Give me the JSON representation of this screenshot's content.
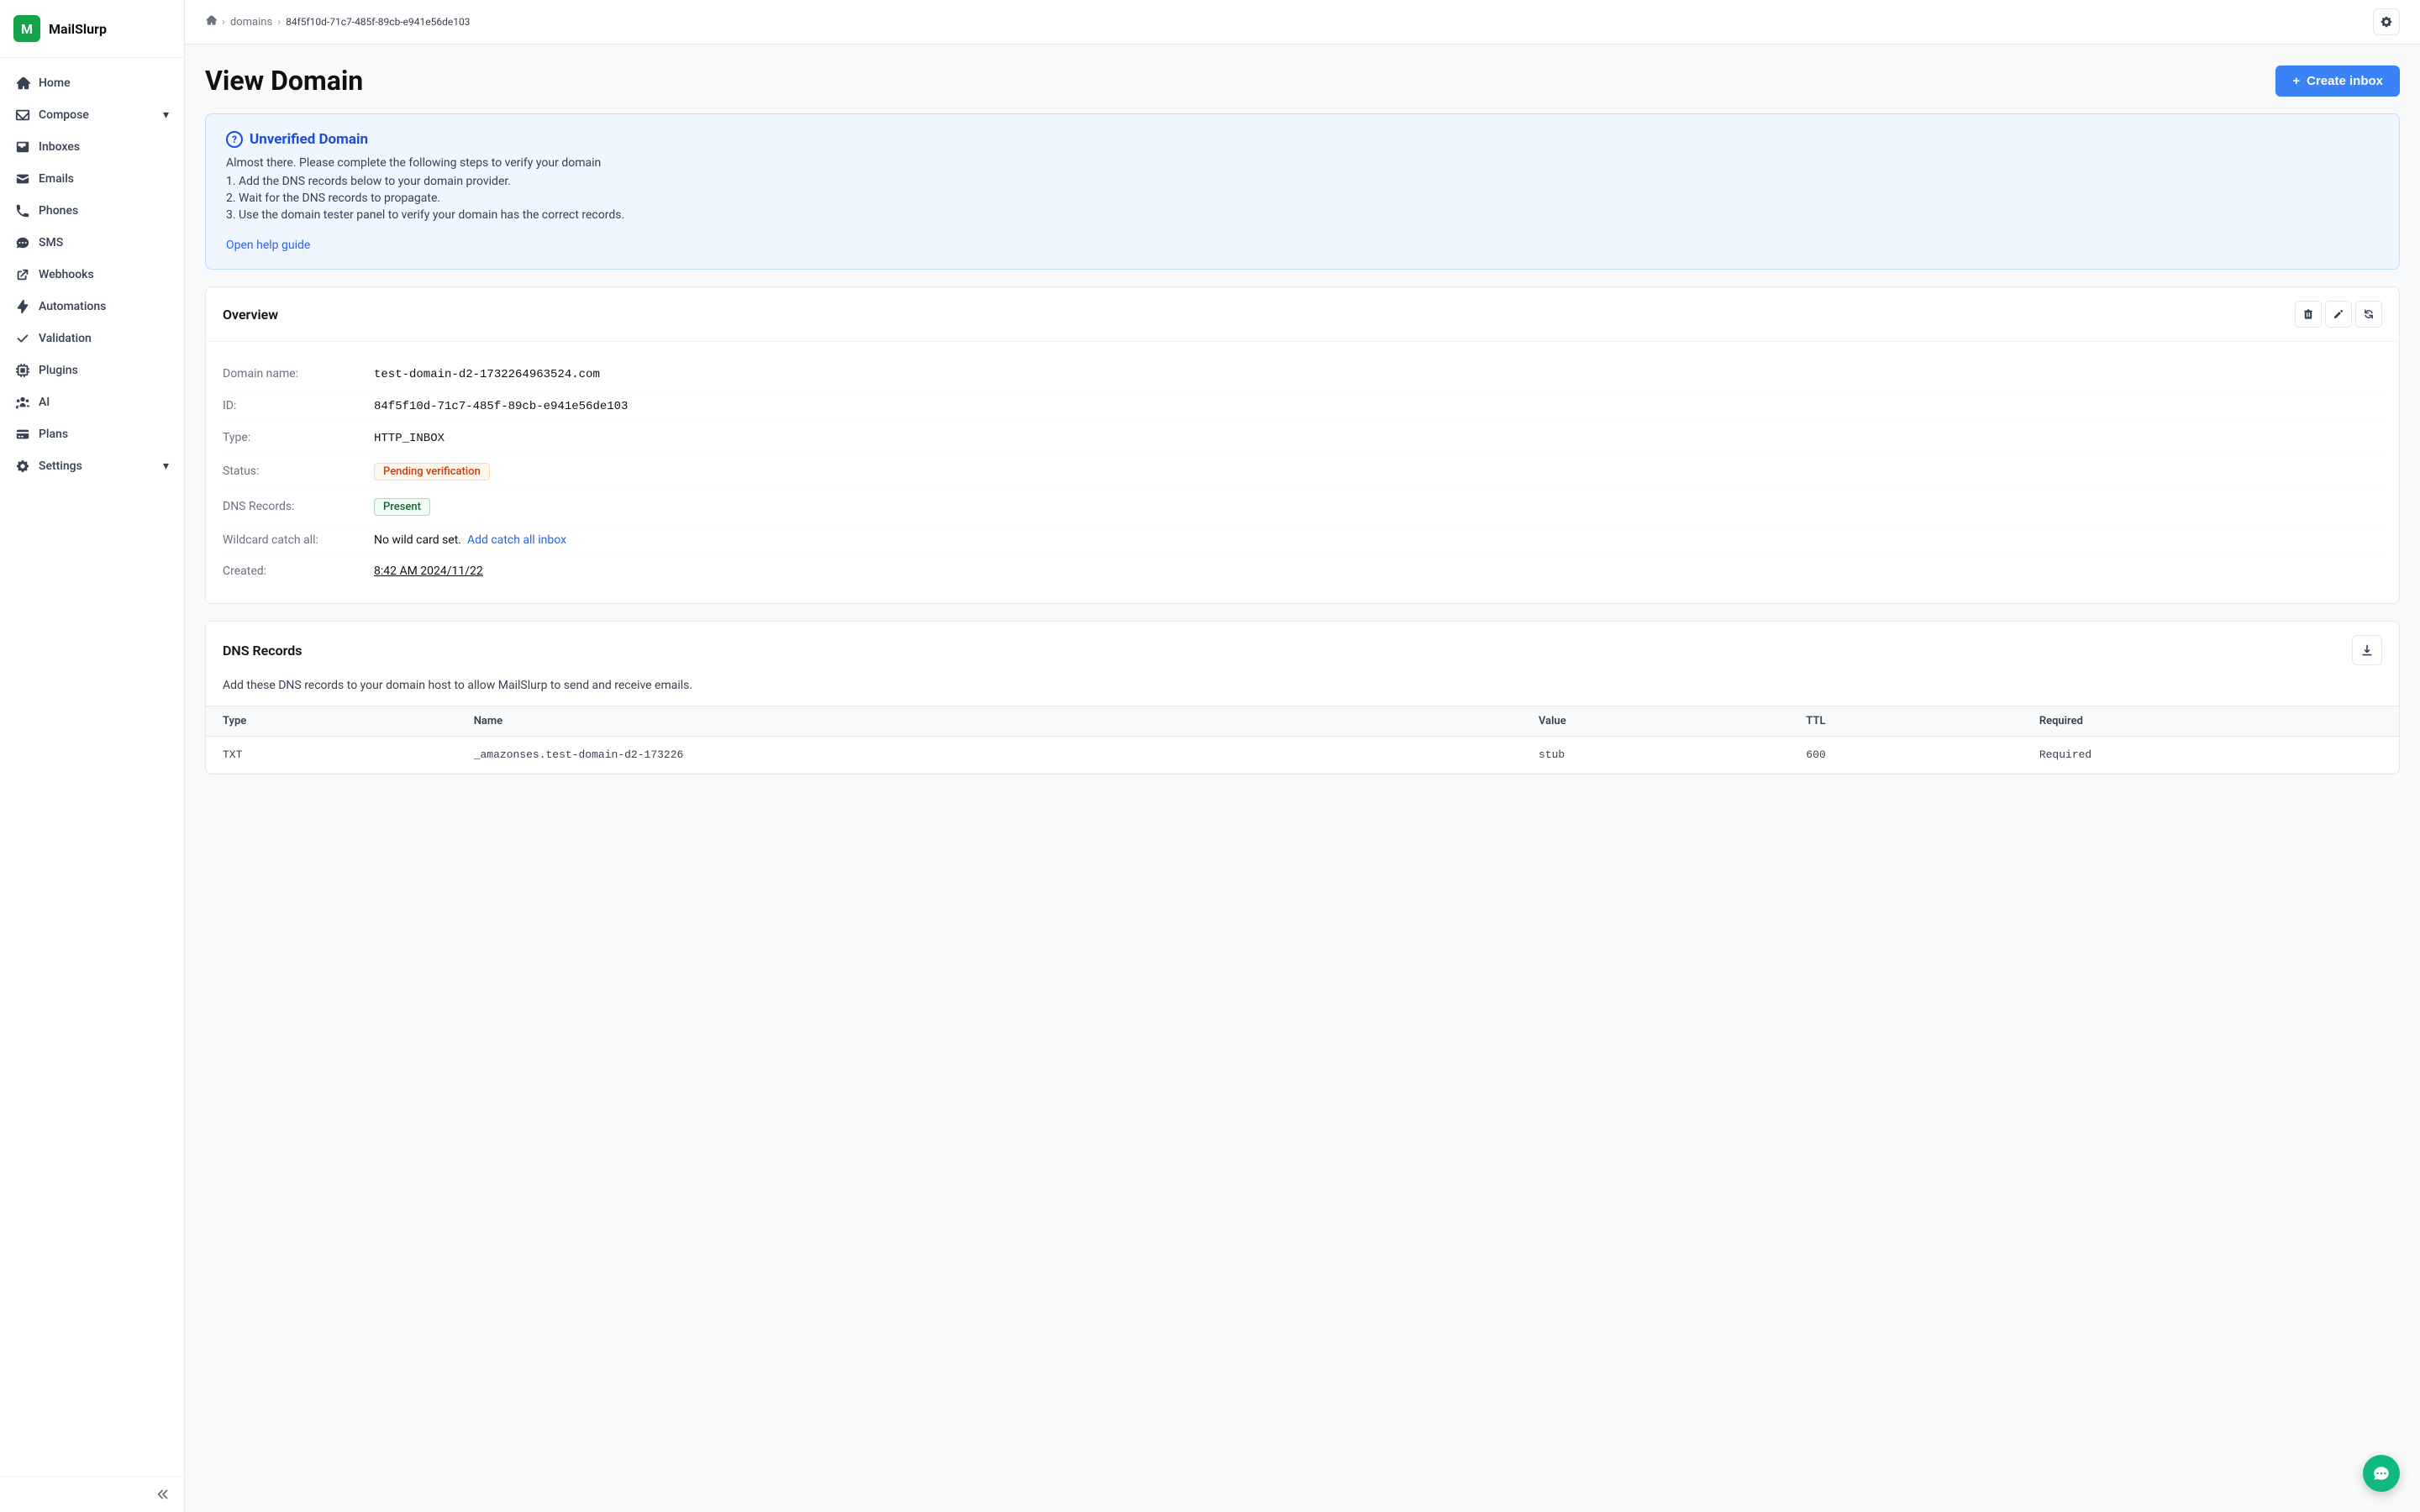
{
  "sidebar": {
    "logo": {
      "letter": "M",
      "name": "MailSlurp"
    },
    "nav_items": [
      {
        "id": "home",
        "label": "Home",
        "icon": "home"
      },
      {
        "id": "compose",
        "label": "Compose",
        "icon": "compose",
        "has_chevron": true
      },
      {
        "id": "inboxes",
        "label": "Inboxes",
        "icon": "inbox"
      },
      {
        "id": "emails",
        "label": "Emails",
        "icon": "email"
      },
      {
        "id": "phones",
        "label": "Phones",
        "icon": "phone"
      },
      {
        "id": "sms",
        "label": "SMS",
        "icon": "sms"
      },
      {
        "id": "webhooks",
        "label": "Webhooks",
        "icon": "webhook"
      },
      {
        "id": "automations",
        "label": "Automations",
        "icon": "automation"
      },
      {
        "id": "validation",
        "label": "Validation",
        "icon": "validation"
      },
      {
        "id": "plugins",
        "label": "Plugins",
        "icon": "plugins"
      },
      {
        "id": "ai",
        "label": "AI",
        "icon": "ai"
      },
      {
        "id": "plans",
        "label": "Plans",
        "icon": "plans"
      },
      {
        "id": "settings",
        "label": "Settings",
        "icon": "settings",
        "has_chevron": true
      }
    ],
    "collapse_label": "Collapse"
  },
  "breadcrumb": {
    "home_icon": "home",
    "domains_label": "domains",
    "domain_id": "84f5f10d-71c7-485f-89cb-e941e56de103"
  },
  "header": {
    "page_title": "View Domain",
    "settings_icon": "gear",
    "create_inbox_label": "Create inbox",
    "create_inbox_plus": "+"
  },
  "alert": {
    "icon": "?",
    "title": "Unverified Domain",
    "subtitle": "Almost there. Please complete the following steps to verify your domain",
    "steps": [
      "1. Add the DNS records below to your domain provider.",
      "2. Wait for the DNS records to propagate.",
      "3. Use the domain tester panel to verify your domain has the correct records."
    ],
    "help_link": "Open help guide"
  },
  "overview": {
    "title": "Overview",
    "delete_icon": "trash",
    "edit_icon": "pencil",
    "refresh_icon": "refresh",
    "fields": [
      {
        "label": "Domain name:",
        "value": "test-domain-d2-1732264963524.com",
        "mono": true
      },
      {
        "label": "ID:",
        "value": "84f5f10d-71c7-485f-89cb-e941e56de103",
        "mono": true
      },
      {
        "label": "Type:",
        "value": "HTTP_INBOX",
        "mono": true
      },
      {
        "label": "Status:",
        "value": "Pending verification",
        "type": "badge-pending"
      },
      {
        "label": "DNS Records:",
        "value": "Present",
        "type": "badge-present"
      },
      {
        "label": "Wildcard catch all:",
        "value": "No wild card set.",
        "link": "Add catch all inbox",
        "mono": false
      },
      {
        "label": "Created:",
        "value": "8:42 AM 2024/11/22",
        "mono": false
      }
    ]
  },
  "dns_records": {
    "title": "DNS Records",
    "description": "Add these DNS records to your domain host to allow MailSlurp to send and receive emails.",
    "download_icon": "download",
    "columns": [
      "Type",
      "Name",
      "Value",
      "TTL",
      "Required"
    ],
    "rows": [
      {
        "type": "TXT",
        "name": "_amazonses.test-domain-d2-173226",
        "value": "stub",
        "ttl": "600",
        "required": "Required"
      }
    ]
  },
  "chat": {
    "icon": "chat"
  }
}
